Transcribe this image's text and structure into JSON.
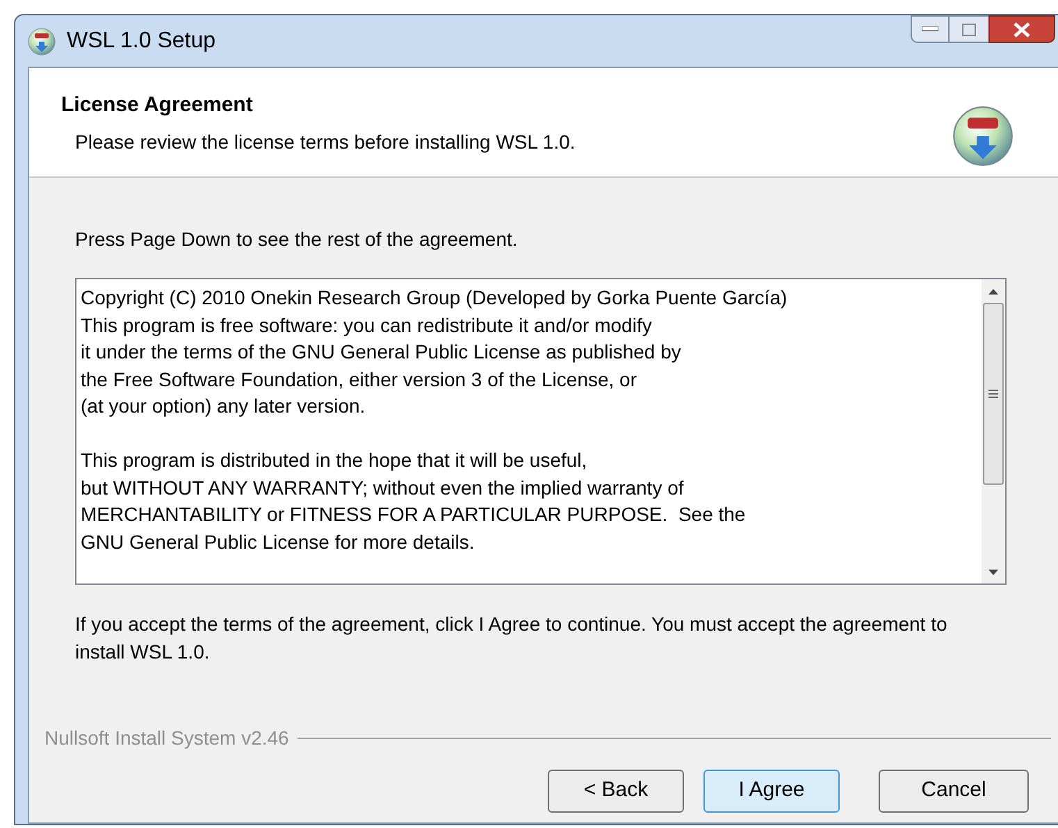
{
  "window": {
    "title": "WSL 1.0 Setup"
  },
  "header": {
    "title": "License Agreement",
    "subtitle": "Please review the license terms before installing WSL 1.0."
  },
  "instruction": "Press Page Down to see the rest of the agreement.",
  "license_text": [
    [
      "Copyright (C) 2010 Onekin Research Group (Developed by Gorka Puente García)",
      "This program is free software: you can redistribute it and/or modify",
      "it under the terms of the GNU General Public License as published by",
      "the Free Software Foundation, either version 3 of the License, or",
      "(at your option) any later version."
    ],
    [
      "This program is distributed in the hope that it will be useful,",
      "but WITHOUT ANY WARRANTY; without even the implied warranty of",
      "MERCHANTABILITY or FITNESS FOR A PARTICULAR PURPOSE.  See the",
      "GNU General Public License for more details."
    ]
  ],
  "accept_note": "If you accept the terms of the agreement, click I Agree to continue. You must accept the agreement to install WSL 1.0.",
  "branding": "Nullsoft Install System v2.46",
  "buttons": [
    {
      "label": "< Back",
      "default": false
    },
    {
      "label": "I Agree",
      "default": true
    },
    {
      "label": "Cancel",
      "default": false
    }
  ]
}
